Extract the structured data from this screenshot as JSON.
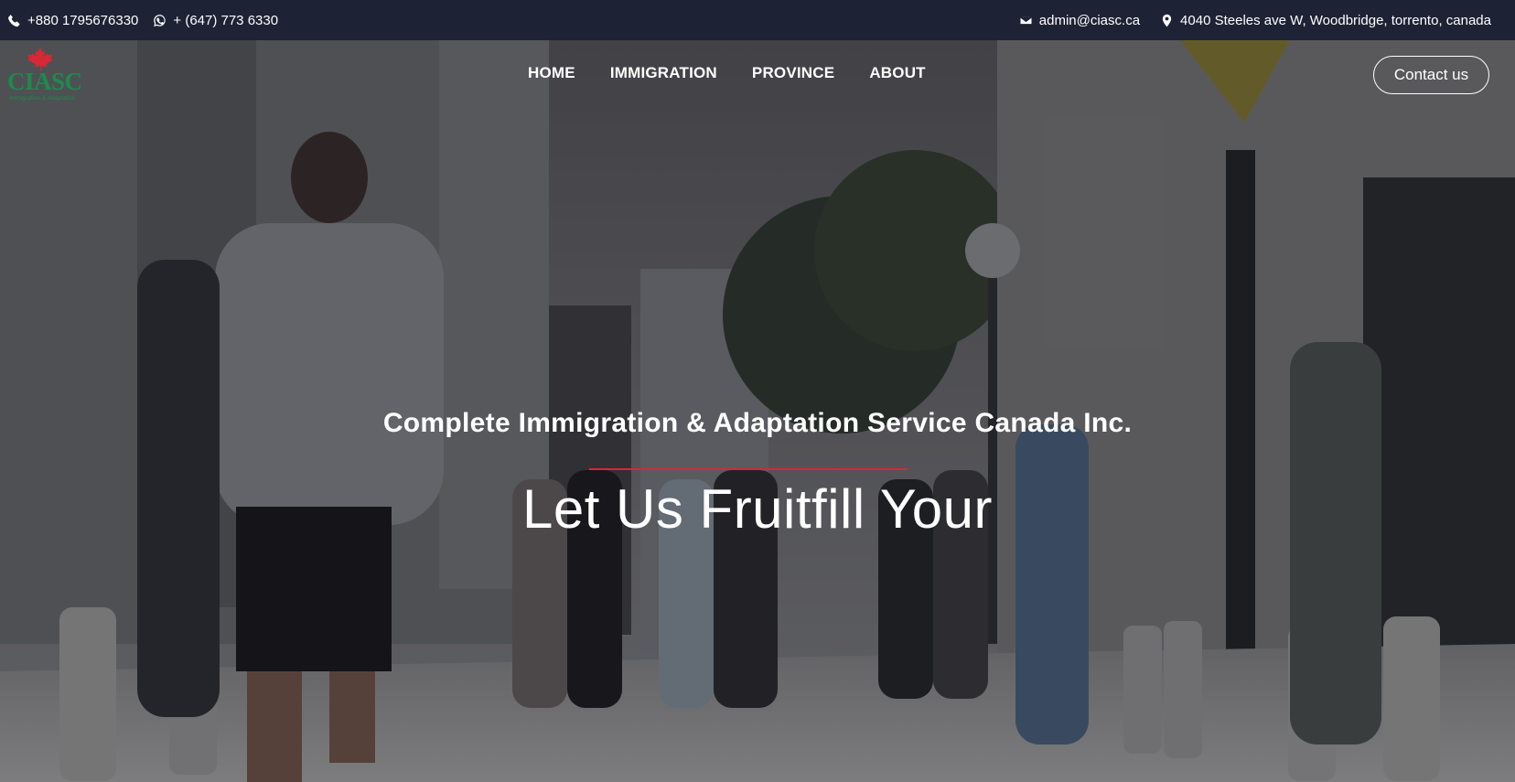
{
  "topbar": {
    "phone": "+880 1795676330",
    "whatsapp": "+ (647) 773 6330",
    "email": "admin@ciasc.ca",
    "address": "4040 Steeles ave W, Woodbridge, torrento, canada",
    "icons": [
      "phone-icon",
      "whatsapp-icon",
      "envelope-icon",
      "map-marker-icon"
    ]
  },
  "logo": {
    "word": "CIASC",
    "tagline": "Immigration & Adaptation"
  },
  "nav": {
    "items": [
      {
        "label": "HOME"
      },
      {
        "label": "IMMIGRATION"
      },
      {
        "label": "PROVINCE"
      },
      {
        "label": "ABOUT"
      }
    ],
    "contact_label": "Contact us"
  },
  "hero": {
    "subtitle": "Complete Immigration & Adaptation Service Canada Inc.",
    "headline": "Let Us Fruitfill Your"
  },
  "colors": {
    "topbar_bg": "#1e2235",
    "accent_red": "#d62835",
    "logo_green": "#1e8a4d"
  }
}
